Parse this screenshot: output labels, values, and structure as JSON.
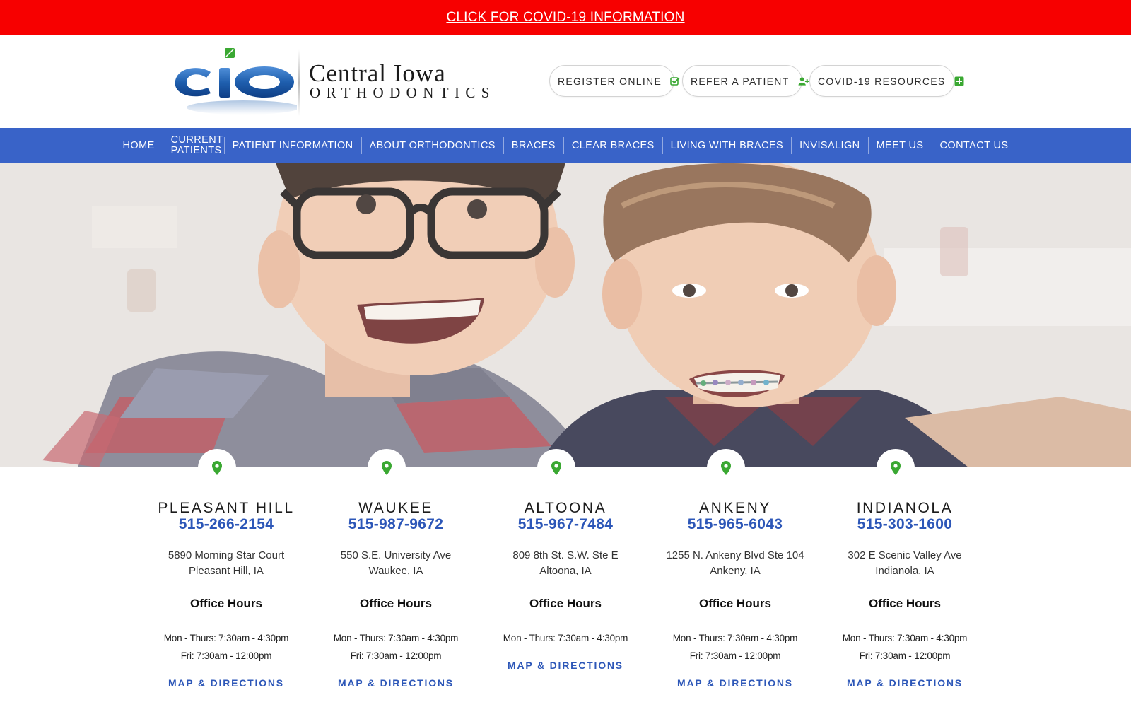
{
  "covid_banner": {
    "link_text": "CLICK FOR COVID-19 INFORMATION"
  },
  "header": {
    "logo": {
      "mark": "cio",
      "name": "Central Iowa",
      "sub": "ORTHODONTICS"
    },
    "buttons": [
      {
        "label": "REGISTER ONLINE",
        "icon": "check-square-icon"
      },
      {
        "label": "REFER A PATIENT",
        "icon": "user-plus-icon"
      },
      {
        "label": "COVID-19 RESOURCES",
        "icon": "plus-square-icon"
      }
    ]
  },
  "nav": {
    "items": [
      {
        "label": "HOME"
      },
      {
        "label": "CURRENT PATIENTS"
      },
      {
        "label": "PATIENT INFORMATION"
      },
      {
        "label": "ABOUT ORTHODONTICS"
      },
      {
        "label": "BRACES"
      },
      {
        "label": "CLEAR BRACES"
      },
      {
        "label": "LIVING WITH BRACES"
      },
      {
        "label": "INVISALIGN"
      },
      {
        "label": "MEET US"
      },
      {
        "label": "CONTACT US"
      }
    ]
  },
  "locations": [
    {
      "name": "PLEASANT HILL",
      "phone": "515-266-2154",
      "address1": "5890 Morning Star Court",
      "address2": "Pleasant Hill, IA",
      "hours_title": "Office Hours",
      "hours": [
        "Mon - Thurs:   7:30am - 4:30pm",
        "Fri:   7:30am - 12:00pm"
      ],
      "map_label": "MAP & DIRECTIONS"
    },
    {
      "name": "WAUKEE",
      "phone": "515-987-9672",
      "address1": "550 S.E. University Ave",
      "address2": "Waukee, IA",
      "hours_title": "Office Hours",
      "hours": [
        "Mon - Thurs:   7:30am - 4:30pm",
        "Fri:   7:30am - 12:00pm"
      ],
      "map_label": "MAP & DIRECTIONS"
    },
    {
      "name": "ALTOONA",
      "phone": "515-967-7484",
      "address1": "809 8th St. S.W. Ste E",
      "address2": "Altoona, IA",
      "hours_title": "Office Hours",
      "hours": [
        "Mon - Thurs:   7:30am - 4:30pm"
      ],
      "map_label": "MAP & DIRECTIONS"
    },
    {
      "name": "ANKENY",
      "phone": "515-965-6043",
      "address1": "1255 N. Ankeny Blvd Ste 104",
      "address2": "Ankeny, IA",
      "hours_title": "Office Hours",
      "hours": [
        "Mon - Thurs:   7:30am - 4:30pm",
        "Fri:   7:30am - 12:00pm"
      ],
      "map_label": "MAP & DIRECTIONS"
    },
    {
      "name": "INDIANOLA",
      "phone": "515-303-1600",
      "address1": "302 E Scenic Valley Ave",
      "address2": "Indianola, IA",
      "hours_title": "Office Hours",
      "hours": [
        "Mon - Thurs:   7:30am - 4:30pm",
        "Fri:   7:30am - 12:00pm"
      ],
      "map_label": "MAP & DIRECTIONS"
    }
  ],
  "colors": {
    "covid_red": "#f70000",
    "nav_blue": "#3963c8",
    "phone_blue": "#2d57b8",
    "pin_green": "#3aa832",
    "logo_blue": "#1f5fae"
  }
}
